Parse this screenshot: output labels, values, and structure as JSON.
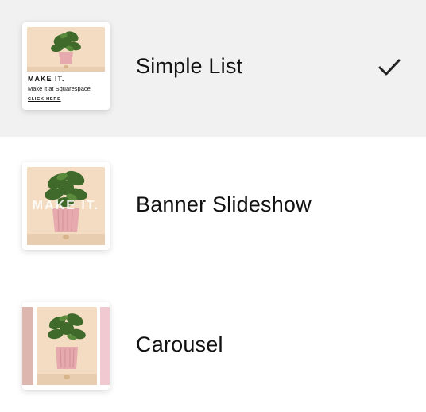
{
  "options": [
    {
      "label": "Simple List",
      "selected": true,
      "thumbnail": {
        "heading": "MAKE IT.",
        "subheading": "Make it at Squarespace",
        "link": "CLICK HERE",
        "icon": "plant-image"
      }
    },
    {
      "label": "Banner Slideshow",
      "selected": false,
      "thumbnail": {
        "overlay_text": "MAKE IT.",
        "icon": "plant-image"
      }
    },
    {
      "label": "Carousel",
      "selected": false,
      "thumbnail": {
        "icon": "plant-image"
      }
    }
  ],
  "selected_icon": "checkmark-icon",
  "colors": {
    "selected_bg": "#f1f1f1",
    "pot": "#e6a9ad",
    "leaf": "#3f6a2b",
    "backdrop": "#f3dcc2"
  }
}
